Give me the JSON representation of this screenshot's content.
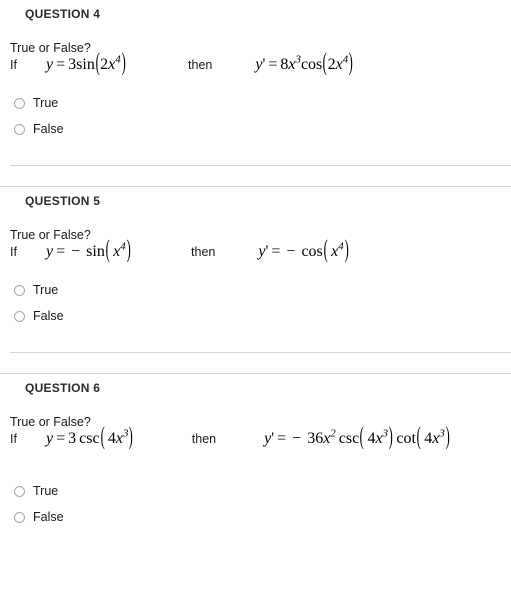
{
  "page": {
    "background_color": "#ffffff",
    "divider_color": "#d4d4d4",
    "text_color": "#1a1a1a",
    "heading_color": "#2b2b2b",
    "radio_border_color": "#a8a8a8"
  },
  "questions": [
    {
      "heading": "QUESTION 4",
      "prompt": "True or False?",
      "if_label": "If",
      "then_label": "then",
      "lhs": {
        "lhs_var": "y",
        "equals": "=",
        "coefficient": "3",
        "function": "sin",
        "open_paren": "(",
        "inner_coefficient": "2",
        "inner_var": "x",
        "inner_exponent": "4",
        "close_paren": ")",
        "plain": "y = 3sin(2x^4)"
      },
      "rhs": {
        "lhs_var": "y",
        "prime": "'",
        "equals": "=",
        "coefficient": "8",
        "var": "x",
        "exponent": "3",
        "function": "cos",
        "open_paren": "(",
        "inner_coefficient": "2",
        "inner_var": "x",
        "inner_exponent": "4",
        "close_paren": ")",
        "plain": "y' = 8x^3 cos(2x^4)"
      },
      "options": [
        {
          "label": "True",
          "selected": false
        },
        {
          "label": "False",
          "selected": false
        }
      ]
    },
    {
      "heading": "QUESTION 5",
      "prompt": "True or False?",
      "if_label": "If",
      "then_label": "then",
      "lhs": {
        "lhs_var": "y",
        "equals": "=",
        "sign": "−",
        "function": "sin",
        "open_paren": "(",
        "inner_var": "x",
        "inner_exponent": "4",
        "close_paren": ")",
        "plain": "y = - sin(x^4)"
      },
      "rhs": {
        "lhs_var": "y",
        "prime": "'",
        "equals": "=",
        "sign": "−",
        "function": "cos",
        "open_paren": "(",
        "inner_var": "x",
        "inner_exponent": "4",
        "close_paren": ")",
        "plain": "y' = - cos(x^4)"
      },
      "options": [
        {
          "label": "True",
          "selected": false
        },
        {
          "label": "False",
          "selected": false
        }
      ]
    },
    {
      "heading": "QUESTION 6",
      "prompt": "True or False?",
      "if_label": "If",
      "then_label": "then",
      "lhs": {
        "lhs_var": "y",
        "equals": "=",
        "coefficient": "3",
        "function": "csc",
        "open_paren": "(",
        "inner_coefficient": "4",
        "inner_var": "x",
        "inner_exponent": "3",
        "close_paren": ")",
        "plain": "y = 3 csc(4x^3)"
      },
      "rhs": {
        "lhs_var": "y",
        "prime": "'",
        "equals": "=",
        "sign": "−",
        "coefficient": "36",
        "var": "x",
        "exponent": "2",
        "function1": "csc",
        "function2": "cot",
        "open_paren": "(",
        "inner_coefficient": "4",
        "inner_var": "x",
        "inner_exponent": "3",
        "close_paren": ")",
        "plain": "y' = - 36x^2 csc(4x^3) cot(4x^3)"
      },
      "options": [
        {
          "label": "True",
          "selected": false
        },
        {
          "label": "False",
          "selected": false
        }
      ]
    }
  ]
}
